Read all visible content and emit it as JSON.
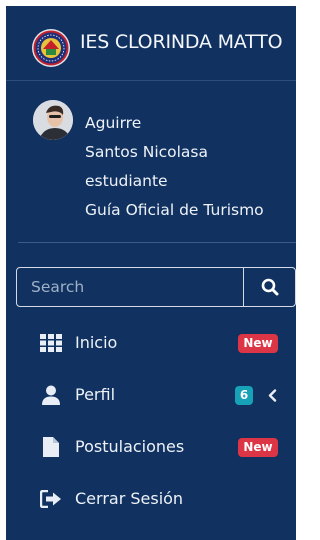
{
  "brand": {
    "title": "IES CLORINDA MATTO",
    "logo_icon": "institution-seal-icon"
  },
  "user": {
    "lines": [
      "Aguirre",
      "Santos Nicolasa",
      "estudiante",
      "Guía Oficial de Turismo"
    ],
    "avatar_icon": "user-avatar"
  },
  "search": {
    "placeholder": "Search",
    "button_icon": "search-icon"
  },
  "menu": [
    {
      "label": "Inicio",
      "icon": "grid-icon",
      "badge": "New",
      "badge_color": "#dc3545"
    },
    {
      "label": "Perfil",
      "icon": "user-icon",
      "badge": "6",
      "badge_color": "#17a2b8",
      "chevron": "chevron-left-icon"
    },
    {
      "label": "Postulaciones",
      "icon": "file-icon",
      "badge": "New",
      "badge_color": "#dc3545"
    },
    {
      "label": "Cerrar Sesión",
      "icon": "sign-out-icon"
    }
  ],
  "colors": {
    "sidebar_bg": "#113260",
    "badge_new": "#dc3545",
    "badge_count": "#17a2b8"
  }
}
